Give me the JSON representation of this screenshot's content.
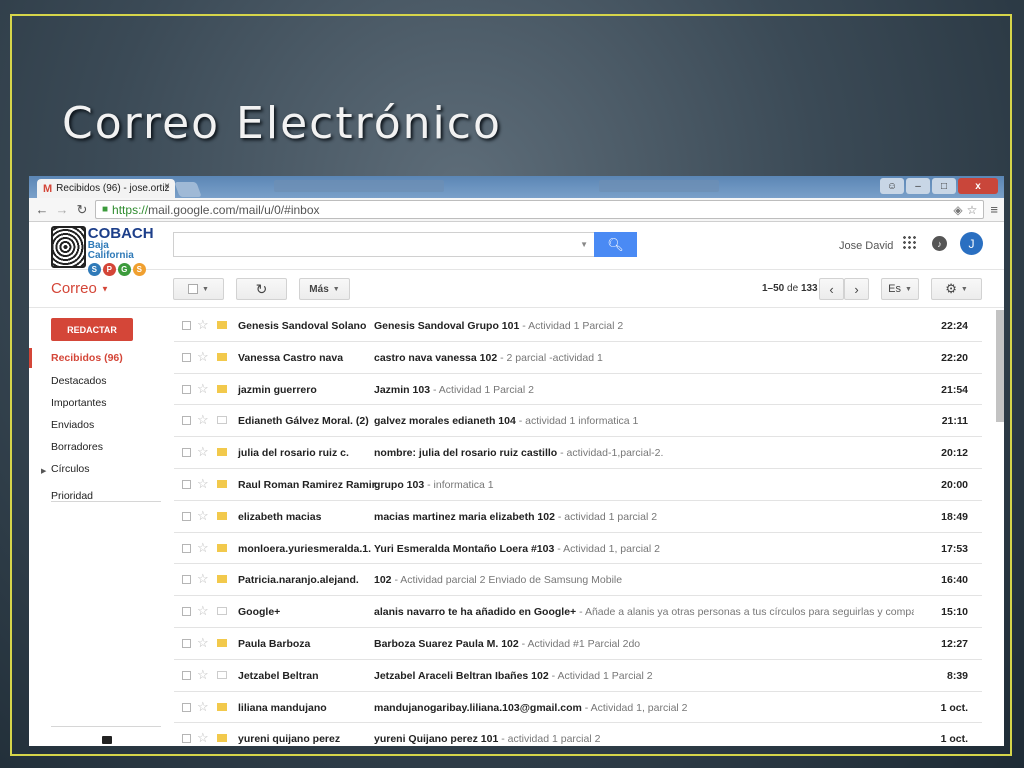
{
  "slide": {
    "title": "Correo Electrónico"
  },
  "browser": {
    "tab_title": "Recibidos (96) - jose.ortiz",
    "tab_close": "×",
    "url_https": "https://",
    "url_rest": "mail.google.com/mail/u/0/#inbox",
    "window_min": "–",
    "window_max": "□",
    "window_close": "x"
  },
  "header": {
    "logo_cobach": "COBACH",
    "logo_bc": "Baja California",
    "logo_dots": [
      {
        "letter": "S",
        "color": "#2f7ab8"
      },
      {
        "letter": "P",
        "color": "#d44638"
      },
      {
        "letter": "G",
        "color": "#3c9b3c"
      },
      {
        "letter": "S",
        "color": "#f0a030"
      }
    ],
    "user_name": "Jose David",
    "avatar_letter": "J"
  },
  "actionbar": {
    "app_label": "Correo",
    "more_label": "Más",
    "page_range": "1–50",
    "page_of": "de",
    "page_total": "133",
    "lang": "Es"
  },
  "sidebar": {
    "compose_label": "REDACTAR",
    "items": [
      "Recibidos (96)",
      "Destacados",
      "Importantes",
      "Enviados",
      "Borradores",
      "Círculos",
      "Prioridad"
    ]
  },
  "emails": [
    {
      "sender": "Genesis Sandoval Solano",
      "subject": "Genesis Sandoval Grupo 101",
      "snippet": " - Actividad 1 Parcial 2",
      "time": "22:24",
      "labeled": true
    },
    {
      "sender": "Vanessa Castro nava",
      "subject": "castro nava vanessa 102",
      "snippet": " - 2 parcial -actividad 1",
      "time": "22:20",
      "labeled": true
    },
    {
      "sender": "jazmin guerrero",
      "subject": "Jazmin 103",
      "snippet": " - Actividad 1 Parcial 2",
      "time": "21:54",
      "labeled": true
    },
    {
      "sender": "Edianeth Gálvez Moral. (2)",
      "subject": "galvez morales edianeth 104",
      "snippet": " - actividad 1 informatica 1",
      "time": "21:11",
      "labeled": false
    },
    {
      "sender": "julia del rosario ruiz c.",
      "subject": "nombre: julia del rosario ruiz castillo",
      "snippet": " - actividad-1,parcial-2.",
      "time": "20:12",
      "labeled": true
    },
    {
      "sender": "Raul Roman Ramirez Ramir.",
      "subject": "grupo 103",
      "snippet": " - informatica 1",
      "time": "20:00",
      "labeled": true
    },
    {
      "sender": "elizabeth macias",
      "subject": "macias martinez maria elizabeth 102",
      "snippet": " - actividad 1 parcial 2",
      "time": "18:49",
      "labeled": true
    },
    {
      "sender": "monloera.yuriesmeralda.1.",
      "subject": "Yuri Esmeralda Montaño Loera #103",
      "snippet": " - Actividad 1, parcial 2",
      "time": "17:53",
      "labeled": true
    },
    {
      "sender": "Patricia.naranjo.alejand.",
      "subject": "102",
      "snippet": " - Actividad parcial 2 Enviado de Samsung Mobile",
      "time": "16:40",
      "labeled": true
    },
    {
      "sender": "Google+",
      "subject": "alanis navarro te ha añadido en Google+",
      "snippet": " - Añade a alanis ya otras personas a tus círculos para seguirlas y compartir con ellas.",
      "time": "15:10",
      "labeled": false
    },
    {
      "sender": "Paula Barboza",
      "subject": "Barboza Suarez Paula M. 102",
      "snippet": " - Actividad #1 Parcial 2do",
      "time": "12:27",
      "labeled": true
    },
    {
      "sender": "Jetzabel Beltran",
      "subject": "Jetzabel Araceli Beltran Ibañes 102",
      "snippet": " - Actividad 1 Parcial 2",
      "time": "8:39",
      "labeled": false
    },
    {
      "sender": "liliana mandujano",
      "subject": "mandujanogaribay.liliana.103@gmail.com",
      "snippet": " - Actividad 1, parcial 2",
      "time": "1 oct.",
      "labeled": true
    },
    {
      "sender": "yureni quijano perez",
      "subject": "yureni Quijano perez 101",
      "snippet": " - actividad 1 parcial 2",
      "time": "1 oct.",
      "labeled": true
    }
  ]
}
